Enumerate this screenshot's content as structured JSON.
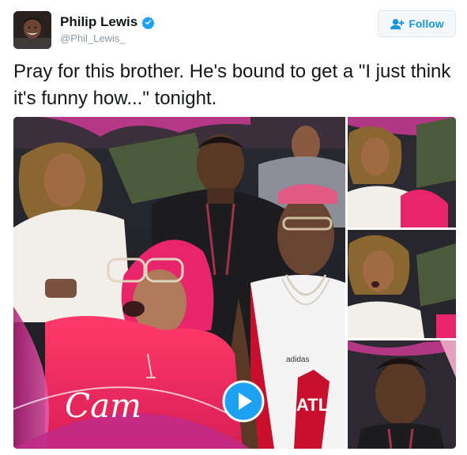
{
  "user": {
    "display_name": "Philip Lewis",
    "handle": "@Phil_Lewis_",
    "verified": true
  },
  "follow_button": {
    "label": "Follow",
    "icon": "add-user-icon"
  },
  "tweet": {
    "text": "Pray for this brother. He's bound to get a \"I just think it's funny how...\" tonight."
  },
  "media": {
    "type": "video",
    "play_icon": "play-icon",
    "caption_overlay": "Cam",
    "thumbnails": 3
  },
  "colors": {
    "accent": "#1b95e0",
    "verified_badge": "#1da1f2",
    "kiss_cam_pink": "#d43b9a"
  }
}
